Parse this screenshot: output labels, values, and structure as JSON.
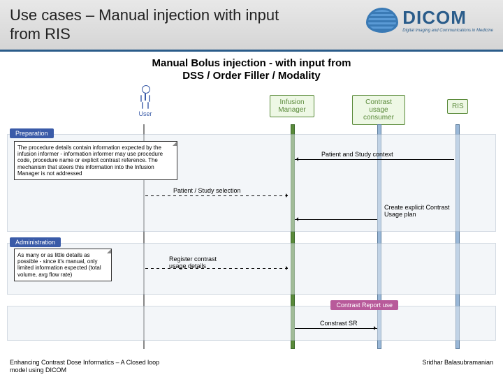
{
  "header": {
    "title": "Use cases – Manual injection with input from RIS"
  },
  "logo": {
    "name": "DICOM",
    "tagline": "Digital Imaging and Communications in Medicine"
  },
  "diagram": {
    "title_l1": "Manual Bolus injection - with input from",
    "title_l2": "DSS / Order Filler / Modality",
    "actors": {
      "user": "User",
      "im": "Infusion Manager",
      "cuc": "Contrast usage consumer",
      "ris": "RIS"
    },
    "phases": {
      "prep": "Preparation",
      "admin": "Administration",
      "report": "Contrast Report use"
    },
    "notes": {
      "prep": "The procedure details contain information expected by the infusion informer - information informer may use procedure code, procedure name or explicit contrast reference. The mechanism that steers this information into the Infusion Manager is not addressed",
      "admin": "As many or as little details as possible - since it's manual, only limited information expected (total volume, avg flow rate)"
    },
    "messages": {
      "m1": "Patient and Study context",
      "m2": "Patient / Study selection",
      "m3": "Create explicit Contrast Usage plan",
      "m4": "Register contrast usage details",
      "m5": "Constrast SR"
    }
  },
  "footer": {
    "left": "Enhancing Contrast Dose Informatics – A Closed loop model using DICOM",
    "right": "Sridhar Balasubramanian"
  }
}
